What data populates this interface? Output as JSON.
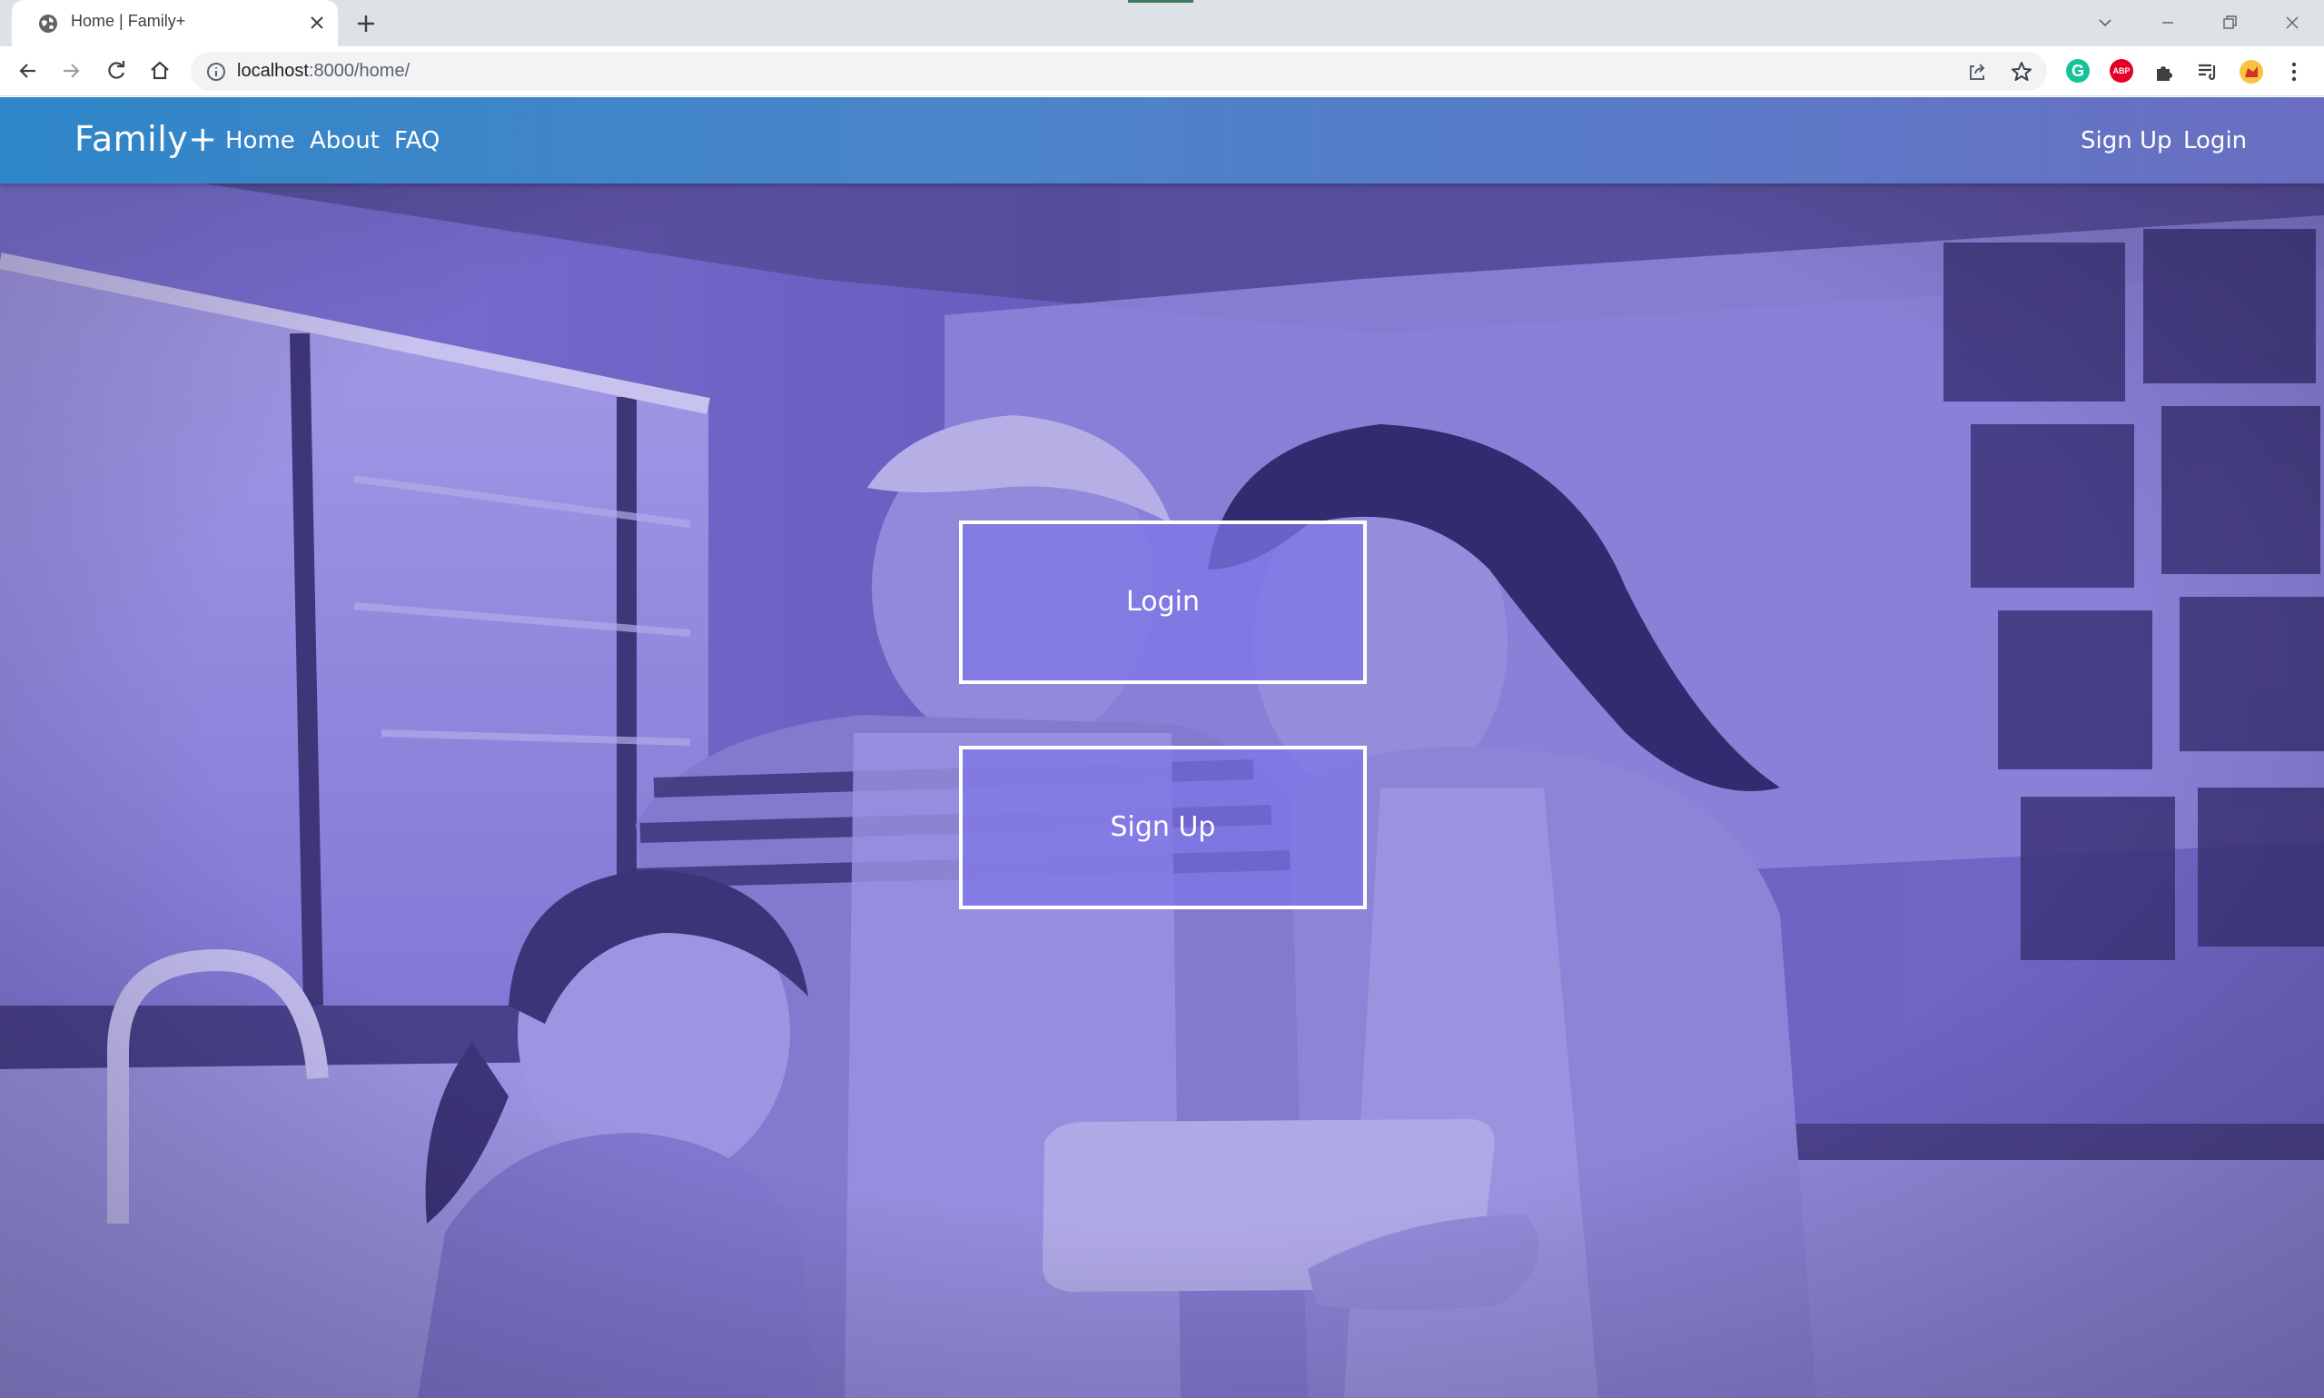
{
  "browser": {
    "tab_title": "Home | Family+",
    "url_host": "localhost",
    "url_path": ":8000/home/",
    "extensions": {
      "grammarly_letter": "G",
      "adblock_letters": "ABP"
    }
  },
  "navbar": {
    "brand": "Family+",
    "links": [
      "Home",
      "About",
      "FAQ"
    ],
    "right_links": [
      "Sign Up",
      "Login"
    ]
  },
  "hero": {
    "login_label": "Login",
    "signup_label": "Sign Up",
    "overlay_color": "#7a70d8",
    "description_icon": "family-kitchen-photo"
  },
  "colors": {
    "navbar_start": "#2e86c8",
    "navbar_end": "#6a6ec1",
    "button_fill": "#7e76e8",
    "grammarly": "#15c39a",
    "adblock": "#e4002b"
  }
}
